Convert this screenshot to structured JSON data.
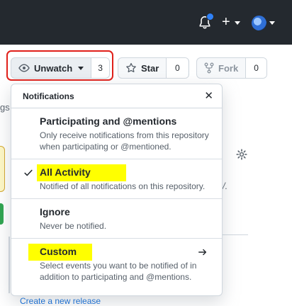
{
  "header": {
    "notification_icon": "bell-icon",
    "create_label": "+",
    "avatar_icon": "avatar"
  },
  "repo_actions": {
    "watch": {
      "label": "Unwatch",
      "count": "3",
      "icon": "eye-icon"
    },
    "star": {
      "label": "Star",
      "count": "0",
      "icon": "star-icon"
    },
    "fork": {
      "label": "Fork",
      "count": "0",
      "icon": "repo-forked-icon"
    }
  },
  "background": {
    "tab_fragment": "gs",
    "slash_fragment": "/.",
    "create_release_link": "Create a new release"
  },
  "notifications_menu": {
    "title": "Notifications",
    "close_symbol": "✕",
    "options": [
      {
        "title": "Participating and @mentions",
        "description": "Only receive notifications from this repository when participating or @mentioned.",
        "selected": false,
        "highlighted": false
      },
      {
        "title": "All Activity",
        "description": "Notified of all notifications on this repository.",
        "selected": true,
        "highlighted": true
      },
      {
        "title": "Ignore",
        "description": "Never be notified.",
        "selected": false,
        "highlighted": false
      },
      {
        "title": "Custom",
        "description": "Select events you want to be notified of in addition to participating and @mentions.",
        "selected": false,
        "highlighted": true,
        "has_submenu": true
      }
    ]
  },
  "colors": {
    "header_bg": "#24292f",
    "annotation_red": "#e0201a",
    "highlighter_yellow": "#ffff00",
    "notification_dot": "#2f81f7"
  }
}
